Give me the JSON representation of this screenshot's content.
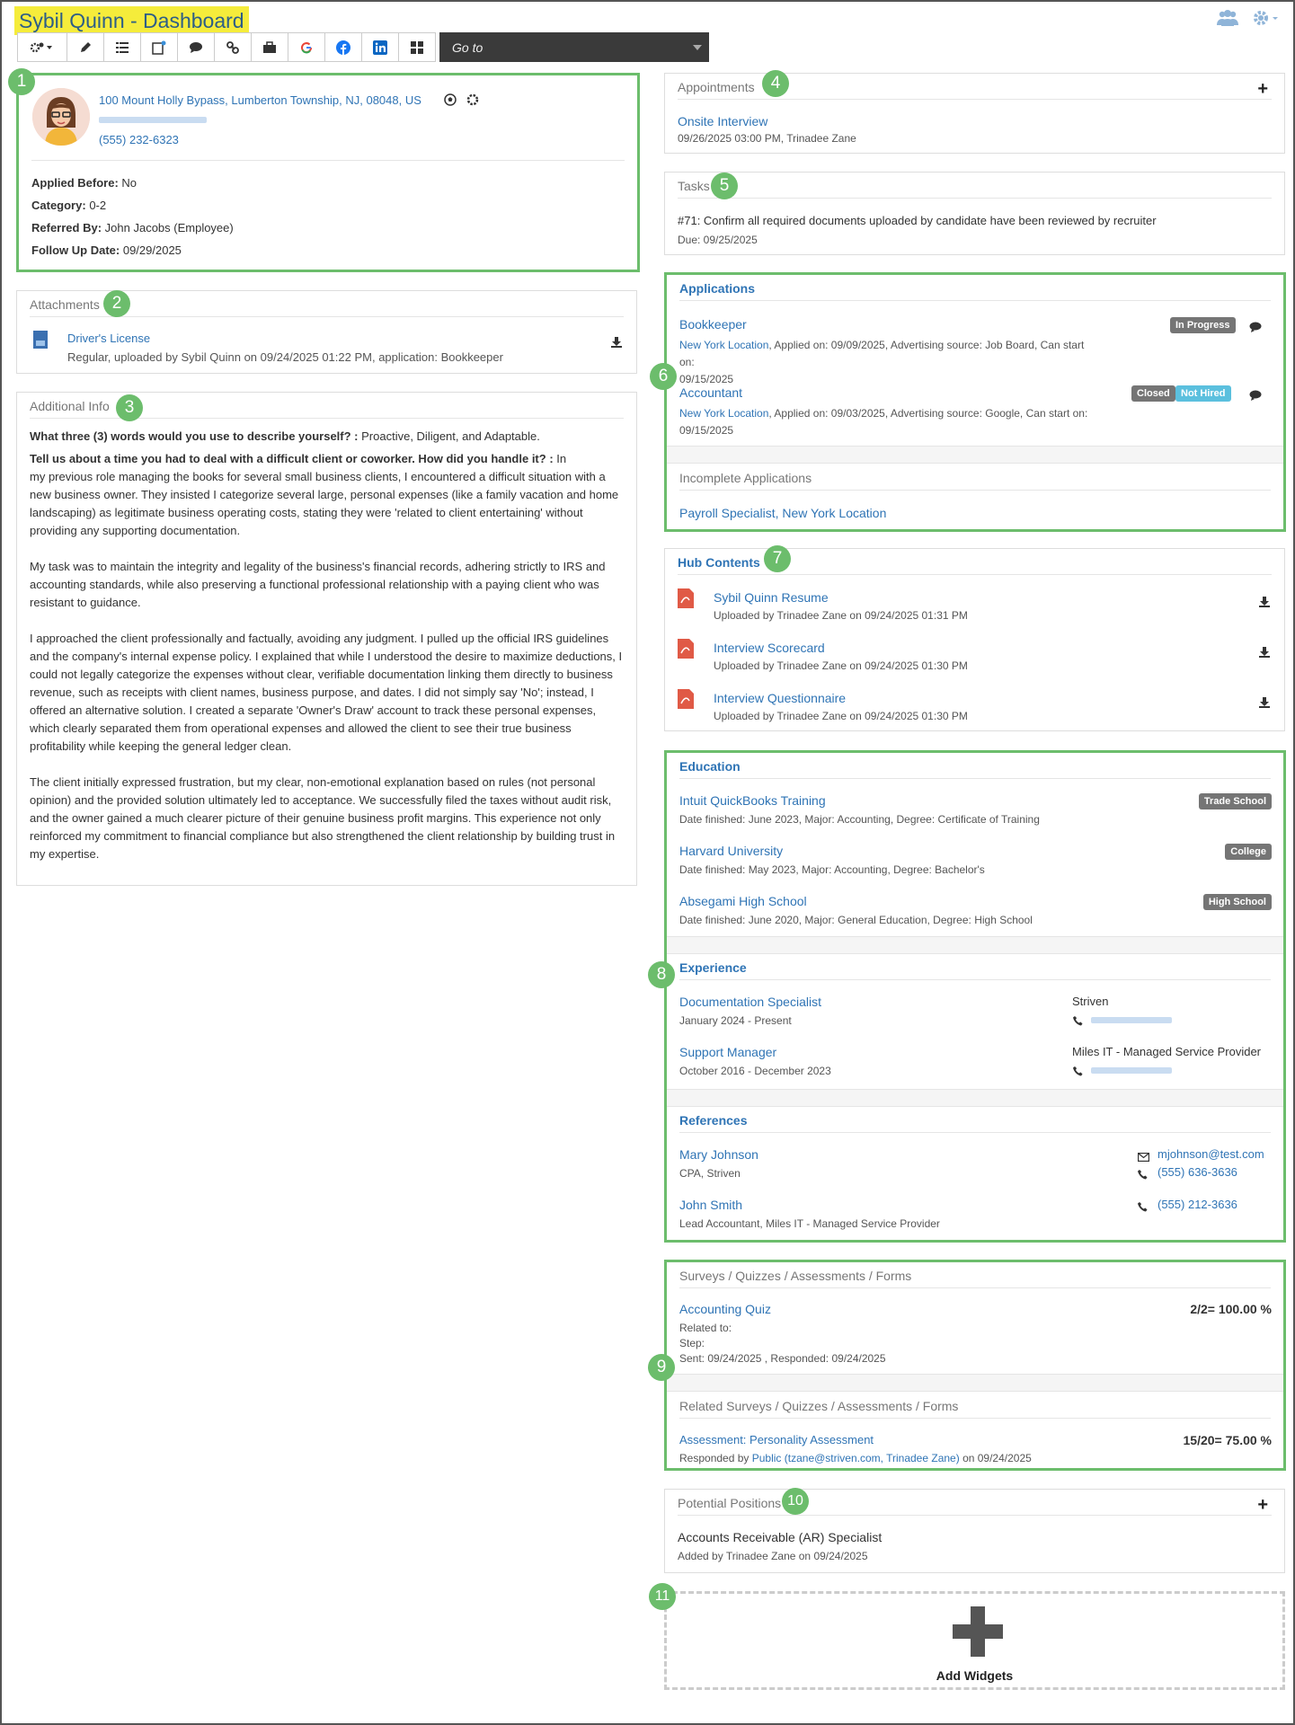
{
  "page_title": "Sybil Quinn - Dashboard",
  "toolbar": {
    "goto": "Go to"
  },
  "profile": {
    "address": "100 Mount Holly Bypass, Lumberton Township, NJ, 08048, US",
    "phone": "(555) 232-6323",
    "fields": [
      {
        "label": "Applied Before:",
        "value": "No"
      },
      {
        "label": "Category:",
        "value": "0-2"
      },
      {
        "label": "Referred By:",
        "value": "John Jacobs (Employee)"
      },
      {
        "label": "Follow Up Date:",
        "value": "09/29/2025"
      }
    ]
  },
  "attachments": {
    "title": "Attachments",
    "name": "Driver's License",
    "detail": "Regular, uploaded by Sybil Quinn on 09/24/2025 01:22 PM, application: Bookkeeper"
  },
  "additional_info": {
    "title": "Additional Info",
    "q1": "What three (3) words would you use to describe yourself? :",
    "a1": "Proactive, Diligent, and Adaptable.",
    "q2": "Tell us about a time you had to deal with a difficult client or coworker. How did you handle it? :",
    "a2_lead": "In",
    "p1": "my previous role managing the books for several small business clients, I encountered a difficult situation with a new business owner. They insisted I categorize several large, personal expenses (like a family vacation and home landscaping) as legitimate business operating costs, stating they were 'related to client entertaining' without providing any supporting documentation.",
    "p2": "My task was to maintain the integrity and legality of the business's financial records, adhering strictly to IRS and accounting standards, while also preserving a functional professional relationship with a paying client who was resistant to guidance.",
    "p3": "I approached the client professionally and factually, avoiding any judgment. I pulled up the official IRS guidelines and the company's internal expense policy. I explained that while I understood the desire to maximize deductions, I could not legally categorize the expenses without clear, verifiable documentation linking them directly to business revenue, such as receipts with client names, business purpose, and dates. I did not simply say 'No'; instead, I offered an alternative solution. I created a separate 'Owner's Draw' account to track these personal expenses, which clearly separated them from operational expenses and allowed the client to see their true business profitability while keeping the general ledger clean.",
    "p4": "The client initially expressed frustration, but my clear, non-emotional explanation based on rules (not personal opinion) and the provided solution ultimately led to acceptance. We successfully filed the taxes without audit risk, and the owner gained a much clearer picture of their genuine business profit margins. This experience not only reinforced my commitment to financial compliance but also strengthened the client relationship by building trust in my expertise."
  },
  "appointments": {
    "title": "Appointments",
    "name": "Onsite Interview",
    "detail": "09/26/2025 03:00 PM, Trinadee Zane"
  },
  "tasks": {
    "title": "Tasks",
    "name": "#71: Confirm all required documents uploaded by candidate have been reviewed by recruiter",
    "due": "Due: 09/25/2025"
  },
  "applications": {
    "title": "Applications",
    "items": [
      {
        "job": "Bookkeeper",
        "loc": "New York Location",
        "detail": ", Applied on: 09/09/2025, Advertising source: Job Board, Can start on:",
        "date": "09/15/2025",
        "badges": [
          "In Progress"
        ]
      },
      {
        "job": "Accountant",
        "loc": "New York Location",
        "detail": ", Applied on: 09/03/2025, Advertising source: Google, Can start on:",
        "date": "09/15/2025",
        "badges": [
          "Closed",
          "Not Hired"
        ]
      }
    ],
    "incomplete_title": "Incomplete Applications",
    "incomplete_job": "Payroll Specialist",
    "incomplete_loc": "New York Location"
  },
  "hub": {
    "title": "Hub Contents",
    "items": [
      {
        "name": "Sybil Quinn Resume",
        "detail": "Uploaded by Trinadee Zane on 09/24/2025 01:31 PM"
      },
      {
        "name": "Interview Scorecard",
        "detail": "Uploaded by Trinadee Zane on 09/24/2025 01:30 PM"
      },
      {
        "name": "Interview Questionnaire",
        "detail": "Uploaded by Trinadee Zane on 09/24/2025 01:30 PM"
      }
    ]
  },
  "education": {
    "title": "Education",
    "items": [
      {
        "name": "Intuit QuickBooks Training",
        "detail": "Date finished: June 2023, Major: Accounting, Degree: Certificate of Training",
        "badge": "Trade School"
      },
      {
        "name": "Harvard University",
        "detail": "Date finished: May 2023, Major: Accounting, Degree: Bachelor's",
        "badge": "College"
      },
      {
        "name": "Absegami High School",
        "detail": "Date finished: June 2020, Major: General Education, Degree: High School",
        "badge": "High School"
      }
    ]
  },
  "experience": {
    "title": "Experience",
    "items": [
      {
        "role": "Documentation Specialist",
        "dates": "January 2024 - Present",
        "company": "Striven"
      },
      {
        "role": "Support Manager",
        "dates": "October 2016 - December 2023",
        "company": "Miles IT - Managed Service Provider"
      }
    ]
  },
  "references": {
    "title": "References",
    "items": [
      {
        "name": "Mary Johnson",
        "detail": "CPA, Striven",
        "email": "mjohnson@test.com",
        "phone": "(555) 636-3636"
      },
      {
        "name": "John Smith",
        "detail": "Lead Accountant, Miles IT - Managed Service Provider",
        "phone": "(555) 212-3636"
      }
    ]
  },
  "surveys": {
    "title": "Surveys / Quizzes / Assessments / Forms",
    "name": "Accounting Quiz",
    "score": "2/2= 100.00 %",
    "related": "Related to:",
    "step": "Step:",
    "sent": "Sent: 09/24/2025 , Responded: 09/24/2025",
    "related_title": "Related Surveys / Quizzes / Assessments / Forms",
    "rname": "Assessment: Personality Assessment",
    "rscore": "15/20= 75.00 %",
    "r_pre": "Responded by",
    "r_public": "Public",
    "r_email": "(tzane@striven.com,",
    "r_person": "Trinadee Zane)",
    "r_post": "on 09/24/2025"
  },
  "positions": {
    "title": "Potential Positions",
    "name": "Accounts Receivable (AR) Specialist",
    "detail": "Added by Trinadee Zane on 09/24/2025"
  },
  "add_widgets": {
    "label": "Add Widgets"
  },
  "markers": [
    "1",
    "2",
    "3",
    "4",
    "5",
    "6",
    "7",
    "8",
    "9",
    "10",
    "11"
  ],
  "colors": {
    "accent": "#2f74b5",
    "highlight": "#f5ec3b",
    "green": "#6cbd6c",
    "badge_gray": "#757575",
    "badge_blue": "#5bc0de"
  }
}
